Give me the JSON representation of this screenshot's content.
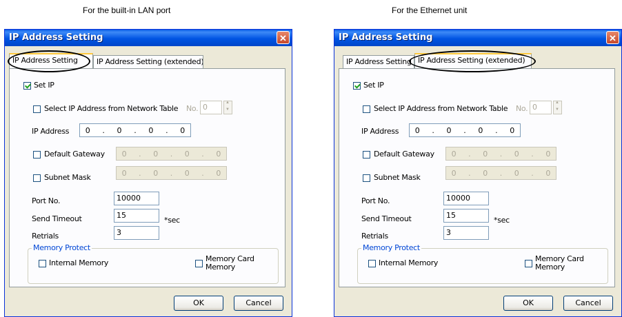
{
  "captions": {
    "left": "For the built-in LAN port",
    "right": "For the Ethernet unit"
  },
  "dialog": {
    "title": "IP Address Setting",
    "close_glyph": "✕",
    "tabs": [
      "IP Address Setting",
      "IP Address Setting (extended)"
    ],
    "set_ip_label": "Set IP",
    "select_from_table_label": "Select IP Address from Network Table",
    "no_label": "No.",
    "no_value": "0",
    "ip_address_label": "IP Address",
    "ip_address": [
      "0",
      "0",
      "0",
      "0"
    ],
    "default_gateway_label": "Default Gateway",
    "default_gateway": [
      "0",
      "0",
      "0",
      "0"
    ],
    "subnet_mask_label": "Subnet Mask",
    "subnet_mask": [
      "0",
      "0",
      "0",
      "0"
    ],
    "port_no_label": "Port No.",
    "port_no": "10000",
    "send_timeout_label": "Send Timeout",
    "send_timeout": "15",
    "send_timeout_unit": "*sec",
    "retrials_label": "Retrials",
    "retrials": "3",
    "memory_protect_label": "Memory Protect",
    "internal_memory_label": "Internal Memory",
    "memory_card_label_1": "Memory Card",
    "memory_card_label_2": "Memory",
    "ok_label": "OK",
    "cancel_label": "Cancel",
    "ip_dot": "."
  },
  "left_dialog": {
    "active_tab": 0,
    "set_ip_checked": true
  },
  "right_dialog": {
    "active_tab": 1,
    "set_ip_checked": true
  },
  "colors": {
    "titlebar": "#0054e3",
    "dialog_bg": "#ece9d8",
    "panel_bg": "#fcfcfe",
    "group_label": "#0046d5",
    "tab_highlight": "#ffc83c"
  }
}
